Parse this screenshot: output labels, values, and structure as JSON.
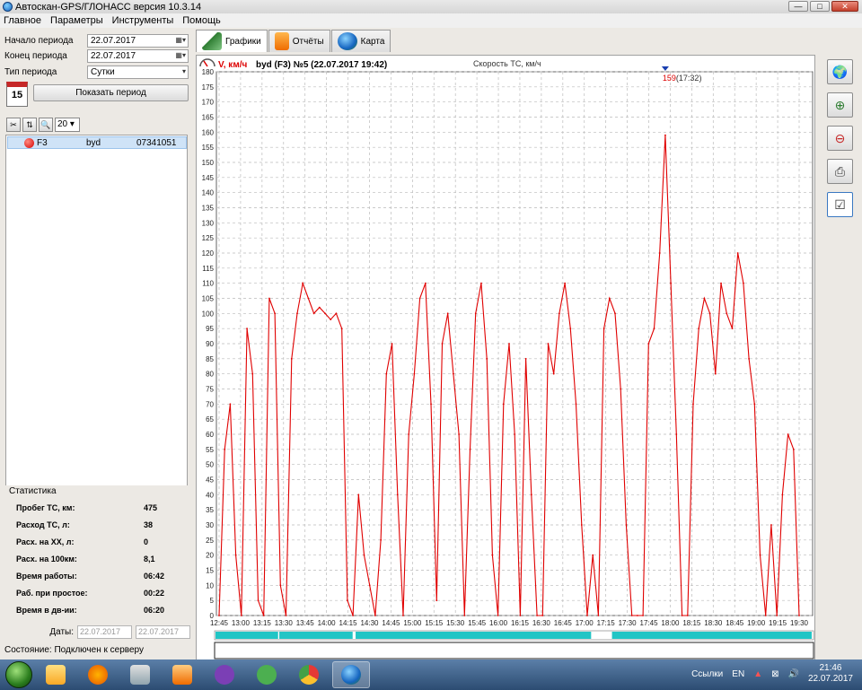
{
  "window": {
    "title": "Автоскан-GPS/ГЛОНАСС версия 10.3.14",
    "min": "—",
    "max": "□",
    "close": "✕"
  },
  "menu": [
    "Главное",
    "Параметры",
    "Инструменты",
    "Помощь"
  ],
  "period": {
    "start_label": "Начало периода",
    "start_value": "22.07.2017",
    "end_label": "Конец периода",
    "end_value": "22.07.2017",
    "type_label": "Тип периода",
    "type_value": "Сутки",
    "show_button": "Показать период",
    "calendar_day": "15"
  },
  "toolbar": {
    "zoom_value": "20"
  },
  "vehicle": {
    "name": "F3",
    "model": "byd",
    "id": "07341051"
  },
  "stats": {
    "title": "Статистика",
    "rows": [
      {
        "label": "Пробег ТС, км:",
        "value": "475"
      },
      {
        "label": "Расход ТС, л:",
        "value": "38"
      },
      {
        "label": "Расх. на ХХ, л:",
        "value": "0"
      },
      {
        "label": "Расх. на 100км:",
        "value": "8,1"
      },
      {
        "label": "Время работы:",
        "value": "06:42"
      },
      {
        "label": "Раб. при простое:",
        "value": "00:22"
      },
      {
        "label": "Время в дв-ии:",
        "value": "06:20"
      }
    ]
  },
  "dates": {
    "label": "Даты:",
    "from": "22.07.2017",
    "to": "22.07.2017"
  },
  "status": {
    "label": "Состояние:",
    "value": "Подключен к серверу"
  },
  "tabs": [
    {
      "label": "Графики",
      "icon": "chart-icon"
    },
    {
      "label": "Отчёты",
      "icon": "report-icon"
    },
    {
      "label": "Карта",
      "icon": "globe-icon"
    }
  ],
  "chart_header": {
    "unit": "V, км/ч",
    "title": "byd (F3) №5 (22.07.2017 19:42)",
    "subtitle": "Скорость ТС, км/ч"
  },
  "marker": {
    "value": "159",
    "time": "(17:32)"
  },
  "colors": {
    "series": "#e00000",
    "timeline": "#22c5c5",
    "accent": "#1565c0"
  },
  "taskbar": {
    "links": "Ссылки",
    "lang": "EN",
    "time": "21:46",
    "date": "22.07.2017"
  },
  "chart_data": {
    "type": "line",
    "title": "Скорость ТС, км/ч",
    "ylabel": "V, км/ч",
    "ylim": [
      0,
      180
    ],
    "yticks": [
      0,
      5,
      10,
      15,
      20,
      25,
      30,
      35,
      40,
      45,
      50,
      55,
      60,
      65,
      70,
      75,
      80,
      85,
      90,
      95,
      100,
      105,
      110,
      115,
      120,
      125,
      130,
      135,
      140,
      145,
      150,
      155,
      160,
      165,
      170,
      175,
      180
    ],
    "xticks": [
      "12:45",
      "13:00",
      "13:15",
      "13:30",
      "13:45",
      "14:00",
      "14:15",
      "14:30",
      "14:45",
      "15:00",
      "15:15",
      "15:30",
      "15:45",
      "16:00",
      "16:15",
      "16:30",
      "16:45",
      "17:00",
      "17:15",
      "17:30",
      "17:45",
      "18:00",
      "18:15",
      "18:30",
      "18:45",
      "19:00",
      "19:15",
      "19:30"
    ],
    "grid": true,
    "series": [
      {
        "values": [
          0,
          55,
          70,
          20,
          0,
          95,
          80,
          5,
          0,
          105,
          100,
          10,
          0,
          85,
          100,
          110,
          105,
          100,
          102,
          100,
          98,
          100,
          95,
          5,
          0,
          40,
          20,
          10,
          0,
          25,
          80,
          90,
          40,
          0,
          60,
          80,
          105,
          110,
          70,
          5,
          90,
          100,
          80,
          60,
          0,
          55,
          100,
          110,
          85,
          20,
          0,
          70,
          90,
          60,
          0,
          85,
          40,
          0,
          0,
          90,
          80,
          100,
          110,
          95,
          70,
          30,
          0,
          20,
          0,
          95,
          105,
          100,
          75,
          30,
          0,
          0,
          0,
          90,
          95,
          120,
          159,
          110,
          60,
          0,
          0,
          70,
          95,
          105,
          100,
          80,
          110,
          100,
          95,
          120,
          110,
          85,
          70,
          20,
          0,
          30,
          0,
          40,
          60,
          55,
          0
        ]
      }
    ],
    "max_label": {
      "value": 159,
      "time": "17:32"
    }
  }
}
